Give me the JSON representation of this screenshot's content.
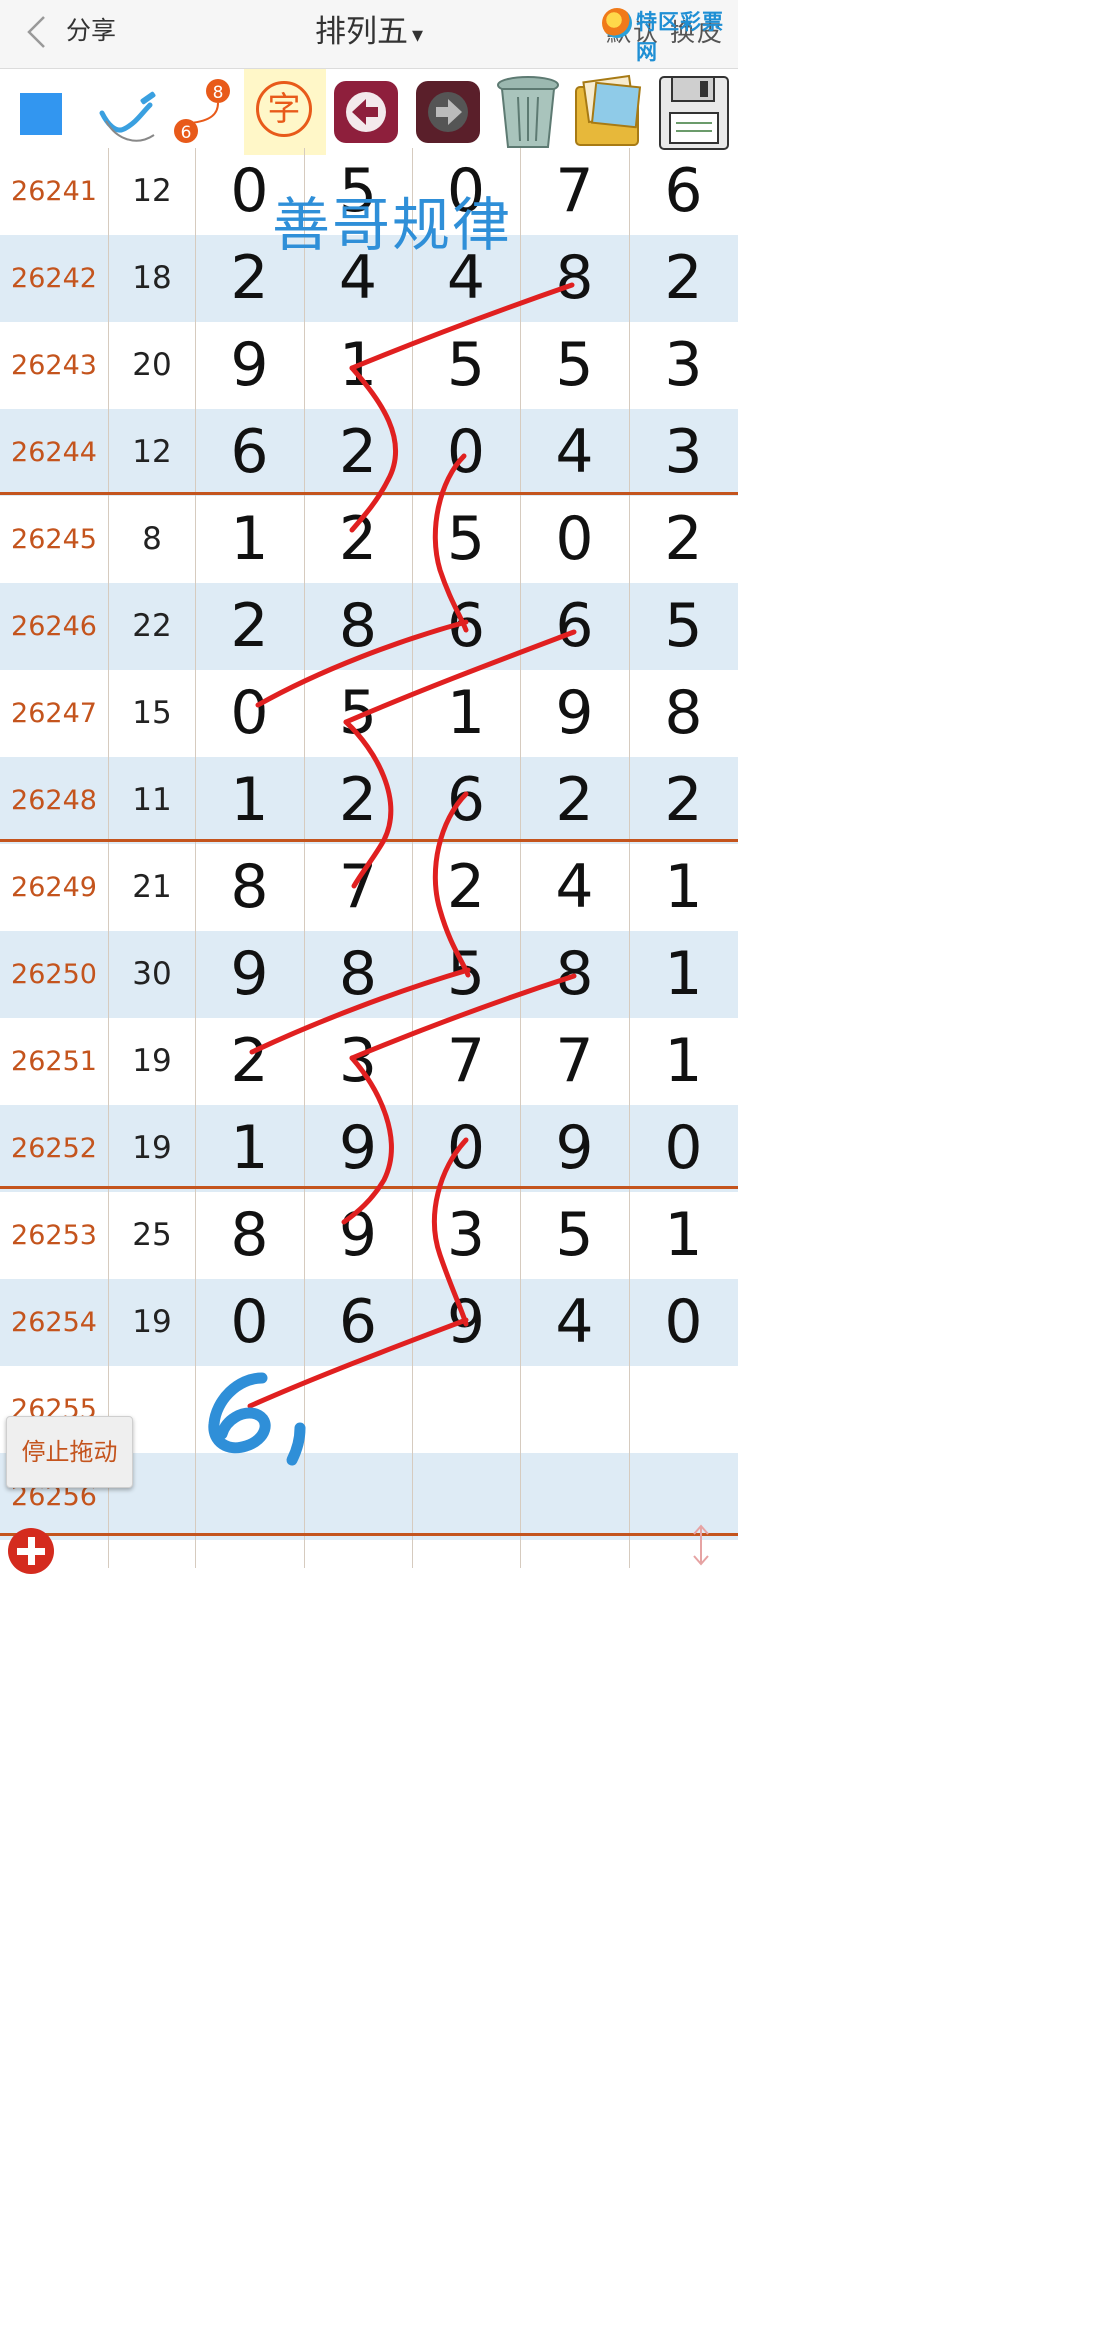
{
  "header": {
    "back_label": "分享",
    "title": "排列五",
    "title_caret": "▾",
    "right_label": "默认 换皮",
    "watermark": "特区彩票网"
  },
  "toolbar": {
    "tools": [
      {
        "name": "color-square",
        "icon": "blue-square-icon"
      },
      {
        "name": "pen",
        "icon": "pen-check-icon"
      },
      {
        "name": "connect",
        "icon": "connect-6-8-icon",
        "from": "6",
        "to": "8"
      },
      {
        "name": "text",
        "icon": "text-char-icon",
        "label": "字"
      },
      {
        "name": "undo",
        "icon": "arrow-left-icon"
      },
      {
        "name": "redo",
        "icon": "arrow-right-icon"
      },
      {
        "name": "trash",
        "icon": "trash-icon"
      },
      {
        "name": "photos",
        "icon": "photos-icon"
      },
      {
        "name": "save",
        "icon": "floppy-disk-icon"
      }
    ]
  },
  "table": {
    "rows": [
      {
        "issue": "26241",
        "sum": "12",
        "digits": [
          "0",
          "5",
          "0",
          "7",
          "6"
        ]
      },
      {
        "issue": "26242",
        "sum": "18",
        "digits": [
          "2",
          "4",
          "4",
          "8",
          "2"
        ]
      },
      {
        "issue": "26243",
        "sum": "20",
        "digits": [
          "9",
          "1",
          "5",
          "5",
          "3"
        ]
      },
      {
        "issue": "26244",
        "sum": "12",
        "digits": [
          "6",
          "2",
          "0",
          "4",
          "3"
        ]
      },
      {
        "issue": "26245",
        "sum": "8",
        "digits": [
          "1",
          "2",
          "5",
          "0",
          "2"
        ]
      },
      {
        "issue": "26246",
        "sum": "22",
        "digits": [
          "2",
          "8",
          "6",
          "6",
          "5"
        ]
      },
      {
        "issue": "26247",
        "sum": "15",
        "digits": [
          "0",
          "5",
          "1",
          "9",
          "8"
        ]
      },
      {
        "issue": "26248",
        "sum": "11",
        "digits": [
          "1",
          "2",
          "6",
          "2",
          "2"
        ]
      },
      {
        "issue": "26249",
        "sum": "21",
        "digits": [
          "8",
          "7",
          "2",
          "4",
          "1"
        ]
      },
      {
        "issue": "26250",
        "sum": "30",
        "digits": [
          "9",
          "8",
          "5",
          "8",
          "1"
        ]
      },
      {
        "issue": "26251",
        "sum": "19",
        "digits": [
          "2",
          "3",
          "7",
          "7",
          "1"
        ]
      },
      {
        "issue": "26252",
        "sum": "19",
        "digits": [
          "1",
          "9",
          "0",
          "9",
          "0"
        ]
      },
      {
        "issue": "26253",
        "sum": "25",
        "digits": [
          "8",
          "9",
          "3",
          "5",
          "1"
        ]
      },
      {
        "issue": "26254",
        "sum": "19",
        "digits": [
          "0",
          "6",
          "9",
          "4",
          "0"
        ]
      },
      {
        "issue": "26255",
        "sum": "",
        "digits": [
          "",
          "",
          "",
          "",
          ""
        ]
      },
      {
        "issue": "26256",
        "sum": "",
        "digits": [
          "",
          "",
          "",
          "",
          ""
        ]
      }
    ]
  },
  "annotations": {
    "title_text": "善哥规律",
    "handwritten": "6,",
    "ink_color": "#e02020",
    "note_color": "#2f8fd8"
  },
  "stop_drag_label": "停止拖动",
  "colors": {
    "issue_text": "#c4541d",
    "alt_row": "#deebf5",
    "separator": "#c4541d",
    "accent_blue": "#3296f0"
  }
}
